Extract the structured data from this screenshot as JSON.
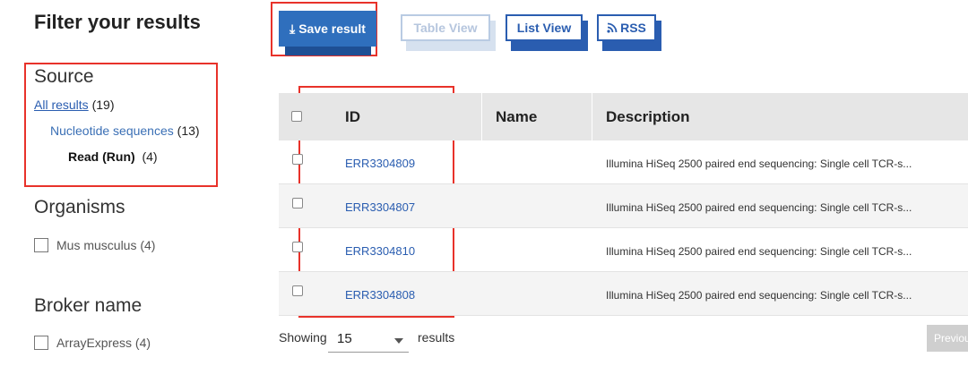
{
  "filter": {
    "title": "Filter your results",
    "source": {
      "title": "Source",
      "all_label": "All results",
      "all_count": "(19)",
      "nucleotide_label": "Nucleotide sequences",
      "nucleotide_count": "(13)",
      "read_label": "Read (Run)",
      "read_count": "(4)"
    },
    "organisms": {
      "title": "Organisms",
      "items": [
        {
          "label": "Mus musculus (4)"
        }
      ]
    },
    "broker": {
      "title": "Broker name",
      "items": [
        {
          "label": "ArrayExpress (4)"
        }
      ]
    }
  },
  "toolbar": {
    "save_label": "Save result",
    "table_view_label": "Table View",
    "list_view_label": "List View",
    "rss_label": "RSS"
  },
  "table": {
    "headers": {
      "id": "ID",
      "name": "Name",
      "description": "Description"
    },
    "rows": [
      {
        "id": "ERR3304809",
        "name": "",
        "description": "Illumina HiSeq 2500 paired end sequencing: Single cell TCR-s..."
      },
      {
        "id": "ERR3304807",
        "name": "",
        "description": "Illumina HiSeq 2500 paired end sequencing: Single cell TCR-s..."
      },
      {
        "id": "ERR3304810",
        "name": "",
        "description": "Illumina HiSeq 2500 paired end sequencing: Single cell TCR-s..."
      },
      {
        "id": "ERR3304808",
        "name": "",
        "description": "Illumina HiSeq 2500 paired end sequencing: Single cell TCR-s..."
      }
    ]
  },
  "pagination": {
    "showing_label": "Showing",
    "page_size": "15",
    "results_label": "results",
    "previous_label": "Previous"
  },
  "colors": {
    "accent": "#2a5db0",
    "highlight": "#e8322a"
  }
}
